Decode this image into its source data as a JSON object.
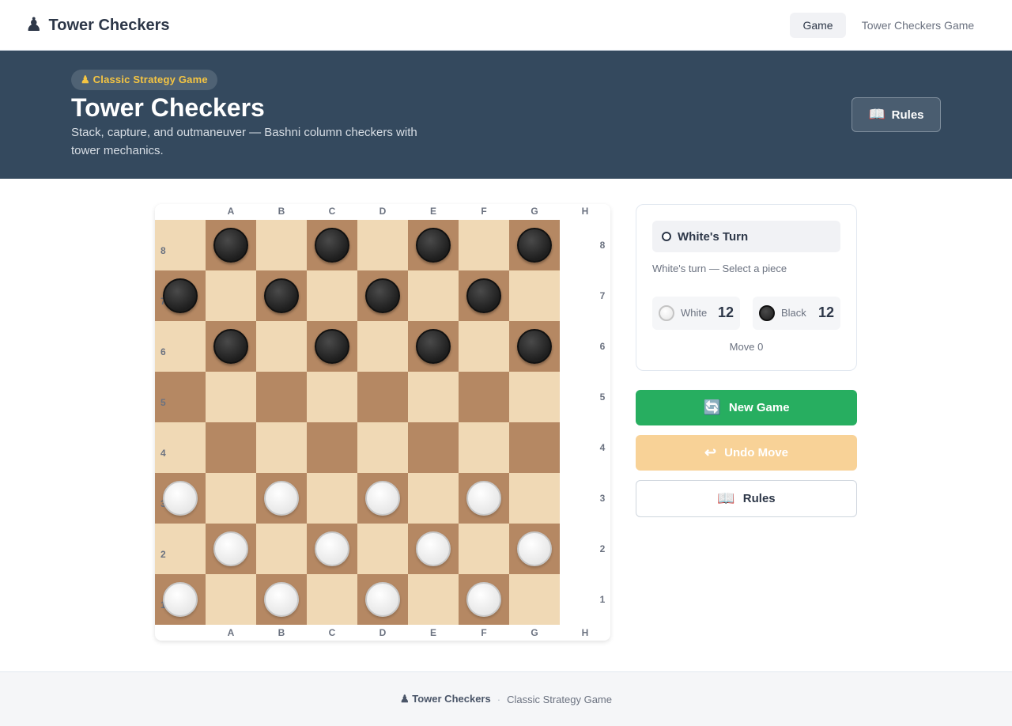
{
  "nav": {
    "brand_icon": "♟",
    "brand": "Tower Checkers",
    "links": [
      "Game",
      "Tower Checkers Game"
    ]
  },
  "hero": {
    "badge": "♟ Classic Strategy Game",
    "title": "Tower Checkers",
    "subtitle": "Stack, capture, and outmaneuver — Bashni column checkers with tower mechanics.",
    "rules_icon": "📖",
    "rules_label": "Rules"
  },
  "board": {
    "files": [
      "A",
      "B",
      "C",
      "D",
      "E",
      "F",
      "G",
      "H"
    ],
    "ranks": [
      "8",
      "7",
      "6",
      "5",
      "4",
      "3",
      "2",
      "1"
    ],
    "colors": {
      "light": "#f0d9b5",
      "dark": "#b58863"
    },
    "pieces": [
      ".b.b.b.b",
      "b.b.b.b.",
      ".b.b.b.b",
      "........",
      "........",
      "w.w.w.w.",
      ".w.w.w.w",
      "w.w.w.w."
    ]
  },
  "panel": {
    "turn_label": "White's Turn",
    "status": "White's turn — Select a piece",
    "white_label": "White",
    "white_count": "12",
    "black_label": "Black",
    "black_count": "12",
    "move_text": "Move 0"
  },
  "buttons": {
    "new_game_icon": "🔄",
    "new_game": "New Game",
    "undo_icon": "↩",
    "undo": "Undo Move",
    "rules_icon": "📖",
    "rules": "Rules"
  },
  "footer": {
    "brand": "♟ Tower Checkers",
    "separator": "·",
    "subtitle": "Classic Strategy Game"
  }
}
